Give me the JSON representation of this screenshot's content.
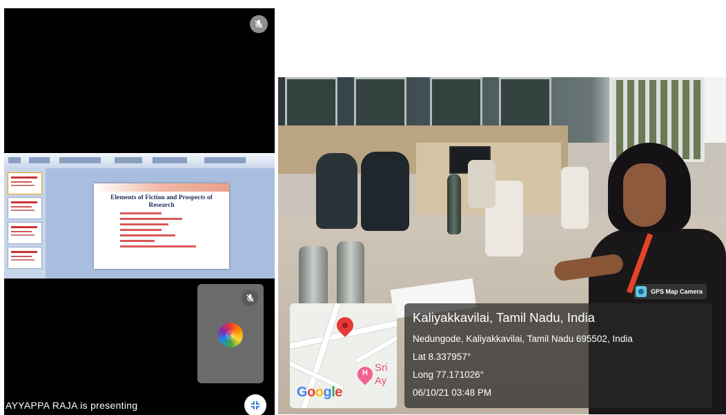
{
  "left_panel": {
    "slide": {
      "title": "Elements of Fiction and Prospects of Research"
    },
    "presenting_text": "AYYAPPA RAJA is presenting"
  },
  "right_panel": {
    "badge": "GPS Map Camera",
    "map": {
      "poi_letter": "H",
      "poi_line1": "Sri",
      "poi_line2": "Ay",
      "logo_letters": [
        "G",
        "o",
        "o",
        "g",
        "l",
        "e"
      ],
      "logo_colors": [
        "#4285F4",
        "#EA4335",
        "#FBBC05",
        "#4285F4",
        "#34A853",
        "#EA4335"
      ]
    },
    "location": {
      "city": "Kaliyakkavilai, Tamil Nadu, India",
      "address": "Nedungode, Kaliyakkavilai, Tamil Nadu 695502, India",
      "lat": "Lat 8.337957°",
      "long": "Long 77.171026°",
      "datetime": "06/10/21 03:48 PM"
    }
  },
  "icons": {
    "mic_off": "mic-off-icon",
    "fullscreen_exit": "fullscreen-exit-icon",
    "map_pin": "map-pin-icon",
    "camera": "camera-icon"
  }
}
